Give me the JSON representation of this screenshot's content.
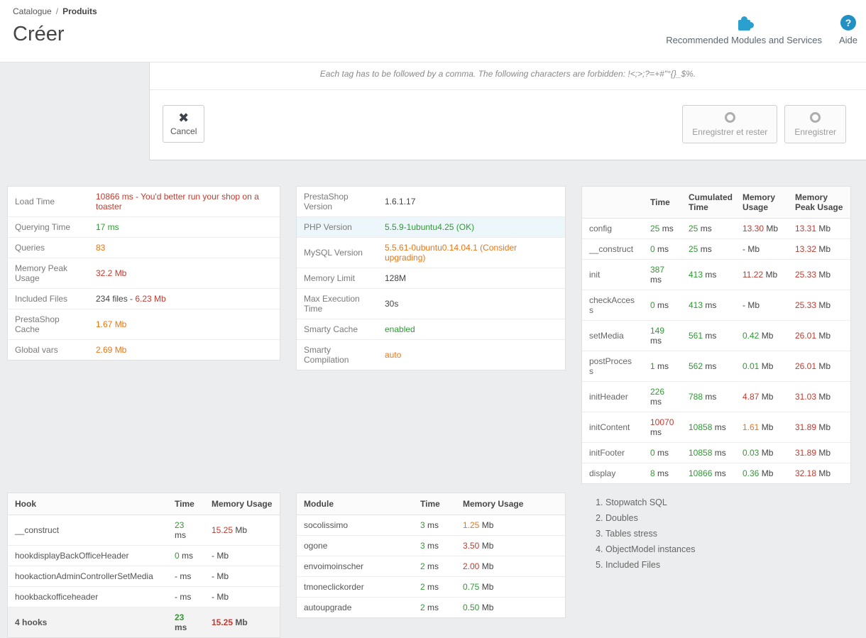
{
  "colors": {
    "green": "#2f9a33",
    "red": "#c43a2f",
    "orange": "#ec7514",
    "accent_blue": "#2b9fcd"
  },
  "header": {
    "breadcrumb": [
      "Catalogue",
      "Produits"
    ],
    "separator": "/",
    "title": "Créer",
    "modules_label": "Recommended Modules and Services",
    "help_label": "Aide",
    "help_glyph": "?"
  },
  "form": {
    "tag_note": "Each tag has to be followed by a comma. The following characters are forbidden: !<;>;?=+#\"°{}_$%.",
    "cancel_label": "Cancel",
    "cancel_glyph": "✖",
    "save_stay_label": "Enregistrer et rester",
    "save_label": "Enregistrer"
  },
  "stats": {
    "rows": [
      {
        "cells": [
          "Load Time",
          [
            {
              "t": "10866 ms - You'd better run your shop on a toaster",
              "c": "red"
            }
          ]
        ]
      },
      {
        "cells": [
          "Querying Time",
          [
            {
              "t": "17 ms",
              "c": "green"
            }
          ]
        ]
      },
      {
        "cells": [
          "Queries",
          [
            {
              "t": "83",
              "c": "orange"
            }
          ]
        ]
      },
      {
        "cells": [
          "Memory Peak Usage",
          [
            {
              "t": "32.2 Mb",
              "c": "red"
            }
          ]
        ]
      },
      {
        "cells": [
          "Included Files",
          [
            {
              "t": "234 files - "
            },
            {
              "t": "6.23 Mb",
              "c": "red"
            }
          ]
        ]
      },
      {
        "cells": [
          "PrestaShop Cache",
          [
            {
              "t": "1.67 Mb",
              "c": "orange"
            }
          ]
        ]
      },
      {
        "cells": [
          "Global vars",
          [
            {
              "t": "2.69 Mb",
              "c": "orange"
            }
          ]
        ]
      }
    ]
  },
  "config": {
    "rows": [
      {
        "cells": [
          "PrestaShop Version",
          [
            {
              "t": "1.6.1.17"
            }
          ]
        ]
      },
      {
        "cells": [
          "PHP Version",
          [
            {
              "t": "5.5.9-1ubuntu4.25 (OK)",
              "c": "green"
            }
          ]
        ],
        "cls": "hl"
      },
      {
        "cells": [
          "MySQL Version",
          [
            {
              "t": "5.5.61-0ubuntu0.14.04.1 (Consider upgrading)",
              "c": "orange"
            }
          ]
        ]
      },
      {
        "cells": [
          "Memory Limit",
          [
            {
              "t": "128M"
            }
          ]
        ]
      },
      {
        "cells": [
          "Max Execution Time",
          [
            {
              "t": "30s"
            }
          ]
        ]
      },
      {
        "cells": [
          "Smarty Cache",
          [
            {
              "t": "enabled",
              "c": "green"
            }
          ]
        ]
      },
      {
        "cells": [
          "Smarty Compilation",
          [
            {
              "t": "auto",
              "c": "orange"
            }
          ]
        ]
      }
    ]
  },
  "process": {
    "headers": [
      "",
      "Time",
      "Cumulated Time",
      "Memory Usage",
      "Memory Peak Usage"
    ],
    "rows": [
      {
        "cells": [
          "config",
          [
            {
              "t": "25",
              "c": "green"
            },
            {
              "t": " ms"
            }
          ],
          [
            {
              "t": "25",
              "c": "green"
            },
            {
              "t": " ms"
            }
          ],
          [
            {
              "t": "13.30",
              "c": "red"
            },
            {
              "t": " Mb"
            }
          ],
          [
            {
              "t": "13.31",
              "c": "red"
            },
            {
              "t": " Mb"
            }
          ]
        ]
      },
      {
        "cells": [
          "__construct",
          [
            {
              "t": "0",
              "c": "green"
            },
            {
              "t": " ms"
            }
          ],
          [
            {
              "t": "25",
              "c": "green"
            },
            {
              "t": " ms"
            }
          ],
          [
            {
              "t": "- Mb"
            }
          ],
          [
            {
              "t": "13.32",
              "c": "red"
            },
            {
              "t": " Mb"
            }
          ]
        ]
      },
      {
        "cells": [
          "init",
          [
            {
              "t": "387",
              "c": "green"
            },
            {
              "t": " ms"
            }
          ],
          [
            {
              "t": "413",
              "c": "green"
            },
            {
              "t": " ms"
            }
          ],
          [
            {
              "t": "11.22",
              "c": "red"
            },
            {
              "t": " Mb"
            }
          ],
          [
            {
              "t": "25.33",
              "c": "red"
            },
            {
              "t": " Mb"
            }
          ]
        ]
      },
      {
        "cells": [
          "checkAccess",
          [
            {
              "t": "0",
              "c": "green"
            },
            {
              "t": " ms"
            }
          ],
          [
            {
              "t": "413",
              "c": "green"
            },
            {
              "t": " ms"
            }
          ],
          [
            {
              "t": "- Mb"
            }
          ],
          [
            {
              "t": "25.33",
              "c": "red"
            },
            {
              "t": " Mb"
            }
          ]
        ]
      },
      {
        "cells": [
          "setMedia",
          [
            {
              "t": "149",
              "c": "green"
            },
            {
              "t": " ms"
            }
          ],
          [
            {
              "t": "561",
              "c": "green"
            },
            {
              "t": " ms"
            }
          ],
          [
            {
              "t": "0.42",
              "c": "green"
            },
            {
              "t": " Mb"
            }
          ],
          [
            {
              "t": "26.01",
              "c": "red"
            },
            {
              "t": " Mb"
            }
          ]
        ]
      },
      {
        "cells": [
          "postProcess",
          [
            {
              "t": "1",
              "c": "green"
            },
            {
              "t": " ms"
            }
          ],
          [
            {
              "t": "562",
              "c": "green"
            },
            {
              "t": " ms"
            }
          ],
          [
            {
              "t": "0.01",
              "c": "green"
            },
            {
              "t": " Mb"
            }
          ],
          [
            {
              "t": "26.01",
              "c": "red"
            },
            {
              "t": " Mb"
            }
          ]
        ]
      },
      {
        "cells": [
          "initHeader",
          [
            {
              "t": "226",
              "c": "green"
            },
            {
              "t": " ms"
            }
          ],
          [
            {
              "t": "788",
              "c": "green"
            },
            {
              "t": " ms"
            }
          ],
          [
            {
              "t": "4.87",
              "c": "red"
            },
            {
              "t": " Mb"
            }
          ],
          [
            {
              "t": "31.03",
              "c": "red"
            },
            {
              "t": " Mb"
            }
          ]
        ]
      },
      {
        "cells": [
          "initContent",
          [
            {
              "t": "10070",
              "c": "red"
            },
            {
              "t": " ms"
            }
          ],
          [
            {
              "t": "10858",
              "c": "green"
            },
            {
              "t": " ms"
            }
          ],
          [
            {
              "t": "1.61",
              "c": "orange"
            },
            {
              "t": " Mb"
            }
          ],
          [
            {
              "t": "31.89",
              "c": "red"
            },
            {
              "t": " Mb"
            }
          ]
        ]
      },
      {
        "cells": [
          "initFooter",
          [
            {
              "t": "0",
              "c": "green"
            },
            {
              "t": " ms"
            }
          ],
          [
            {
              "t": "10858",
              "c": "green"
            },
            {
              "t": " ms"
            }
          ],
          [
            {
              "t": "0.03",
              "c": "green"
            },
            {
              "t": " Mb"
            }
          ],
          [
            {
              "t": "31.89",
              "c": "red"
            },
            {
              "t": " Mb"
            }
          ]
        ]
      },
      {
        "cells": [
          "display",
          [
            {
              "t": "8",
              "c": "green"
            },
            {
              "t": " ms"
            }
          ],
          [
            {
              "t": "10866",
              "c": "green"
            },
            {
              "t": " ms"
            }
          ],
          [
            {
              "t": "0.36",
              "c": "green"
            },
            {
              "t": " Mb"
            }
          ],
          [
            {
              "t": "32.18",
              "c": "red"
            },
            {
              "t": " Mb"
            }
          ]
        ]
      }
    ]
  },
  "hooks": {
    "headers": [
      "Hook",
      "Time",
      "Memory Usage"
    ],
    "rows": [
      {
        "cells": [
          "__construct",
          [
            {
              "t": "23",
              "c": "green"
            },
            {
              "t": " ms"
            }
          ],
          [
            {
              "t": "15.25",
              "c": "red"
            },
            {
              "t": " Mb"
            }
          ]
        ]
      },
      {
        "cells": [
          "hookdisplayBackOfficeHeader",
          [
            {
              "t": "0",
              "c": "green"
            },
            {
              "t": " ms"
            }
          ],
          [
            {
              "t": "- Mb"
            }
          ]
        ]
      },
      {
        "cells": [
          "hookactionAdminControllerSetMedia",
          [
            {
              "t": "- ms"
            }
          ],
          [
            {
              "t": "- Mb"
            }
          ]
        ]
      },
      {
        "cells": [
          "hookbackofficeheader",
          [
            {
              "t": "- ms"
            }
          ],
          [
            {
              "t": "- Mb"
            }
          ]
        ]
      },
      {
        "cells": [
          "4 hooks",
          [
            {
              "t": "23",
              "c": "green"
            },
            {
              "t": " ms"
            }
          ],
          [
            {
              "t": "15.25",
              "c": "red"
            },
            {
              "t": " Mb"
            }
          ]
        ],
        "cls": "total"
      }
    ]
  },
  "modules": {
    "headers": [
      "Module",
      "Time",
      "Memory Usage"
    ],
    "rows": [
      {
        "cells": [
          "socolissimo",
          [
            {
              "t": "3",
              "c": "green"
            },
            {
              "t": " ms"
            }
          ],
          [
            {
              "t": "1.25",
              "c": "orange"
            },
            {
              "t": " Mb"
            }
          ]
        ]
      },
      {
        "cells": [
          "ogone",
          [
            {
              "t": "3",
              "c": "green"
            },
            {
              "t": " ms"
            }
          ],
          [
            {
              "t": "3.50",
              "c": "red"
            },
            {
              "t": " Mb"
            }
          ]
        ]
      },
      {
        "cells": [
          "envoimoinscher",
          [
            {
              "t": "2",
              "c": "green"
            },
            {
              "t": " ms"
            }
          ],
          [
            {
              "t": "2.00",
              "c": "red"
            },
            {
              "t": " Mb"
            }
          ]
        ]
      },
      {
        "cells": [
          "tmoneclickorder",
          [
            {
              "t": "2",
              "c": "green"
            },
            {
              "t": " ms"
            }
          ],
          [
            {
              "t": "0.75",
              "c": "green"
            },
            {
              "t": " Mb"
            }
          ]
        ]
      },
      {
        "cells": [
          "autoupgrade",
          [
            {
              "t": "2",
              "c": "green"
            },
            {
              "t": " ms"
            }
          ],
          [
            {
              "t": "0.50",
              "c": "green"
            },
            {
              "t": " Mb"
            }
          ]
        ]
      }
    ]
  },
  "checklist": {
    "items": [
      "Stopwatch SQL",
      "Doubles",
      "Tables stress",
      "ObjectModel instances",
      "Included Files"
    ]
  }
}
